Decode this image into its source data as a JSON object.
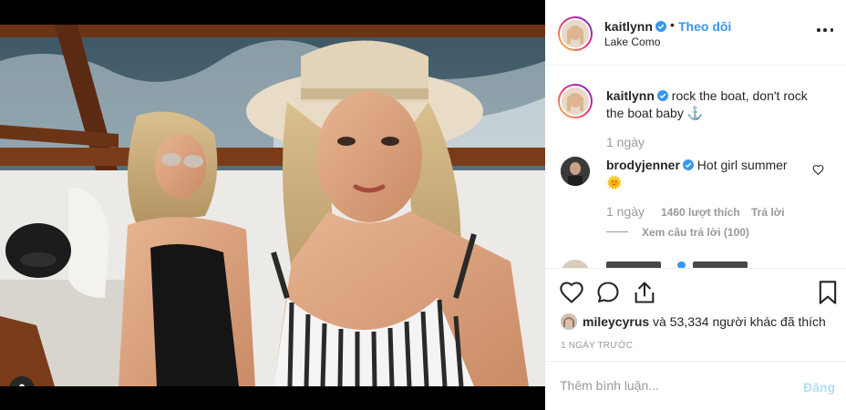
{
  "post": {
    "username": "kaitlynn",
    "follow_label": "Theo dõi",
    "separator": "•",
    "location": "Lake Como",
    "more_icon": "more-options-icon"
  },
  "caption": {
    "username": "kaitlynn",
    "text": "rock the boat, don't rock the boat baby ⚓",
    "time": "1 ngày"
  },
  "comments": [
    {
      "username": "brodyjenner",
      "text": "Hot girl summer",
      "emoji": "🌞",
      "time": "1 ngày",
      "likes": "1460 lượt thích",
      "reply_label": "Trả lời",
      "view_replies": "Xem câu trả lời (100)"
    }
  ],
  "likes": {
    "user": "mileycyrus",
    "text": " và 53,334 người khác đã thích"
  },
  "time_ago": "1 NGÀY TRƯỚC",
  "add_comment": {
    "placeholder": "Thêm bình luận...",
    "post_label": "Đăng"
  },
  "colors": {
    "accent": "#3897f0",
    "post_disabled": "#b2dffc",
    "text": "#262626",
    "muted": "#999999"
  }
}
